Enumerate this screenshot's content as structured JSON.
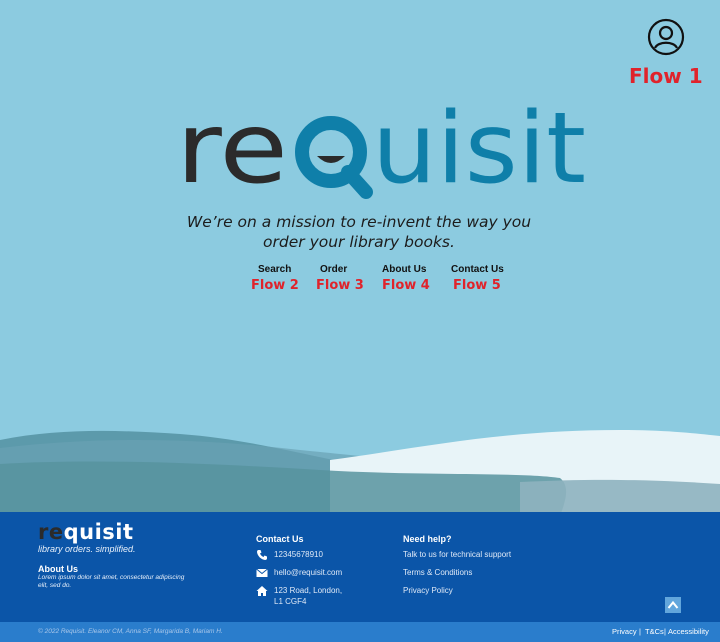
{
  "header": {
    "account_icon": "user-circle-icon",
    "flow1": "Flow 1"
  },
  "hero": {
    "logo": {
      "part1": "re",
      "part2": "uisit",
      "icon": "magnifier-q-icon"
    },
    "tagline_line1": "We’re on a mission to re-invent the way you",
    "tagline_line2": "order your library books."
  },
  "nav": {
    "items": [
      {
        "label": "Search",
        "flow": "Flow 2"
      },
      {
        "label": "Order",
        "flow": "Flow 3"
      },
      {
        "label": "About Us",
        "flow": "Flow 4"
      },
      {
        "label": "Contact Us",
        "flow": "Flow 5"
      }
    ]
  },
  "footer": {
    "logo_re": "re",
    "logo_quisit": "quisit",
    "tagline": "library orders. simplified.",
    "about_heading": "About Us",
    "about_text": "Lorem ipsum dolor sit amet, consectetur adipiscing elit, sed do.",
    "contact_heading": "Contact Us",
    "phone": "12345678910",
    "email": "hello@requisit.com",
    "address_line1": "123 Road, London,",
    "address_line2": "L1 CGF4",
    "help_heading": "Need help?",
    "help_links": [
      "Talk to us for technical support",
      "Terms & Conditions",
      "Privacy Policy"
    ],
    "scroll_top_icon": "chevron-up-icon",
    "copyright": "© 2022 Requisit. Eleanor CM, Anna SF, Margarida B, Mariam H.",
    "legal_links": [
      "Privacy",
      "T&Cs",
      "Accessibility"
    ],
    "separator": "|"
  },
  "colors": {
    "hero_bg": "#8ccbe0",
    "logo_dark": "#2b2b2b",
    "logo_blue": "#0f7fa9",
    "flow_red": "#e0232b",
    "footer_bg": "#0b55a8",
    "bottom_bar": "#2a7dcc"
  }
}
